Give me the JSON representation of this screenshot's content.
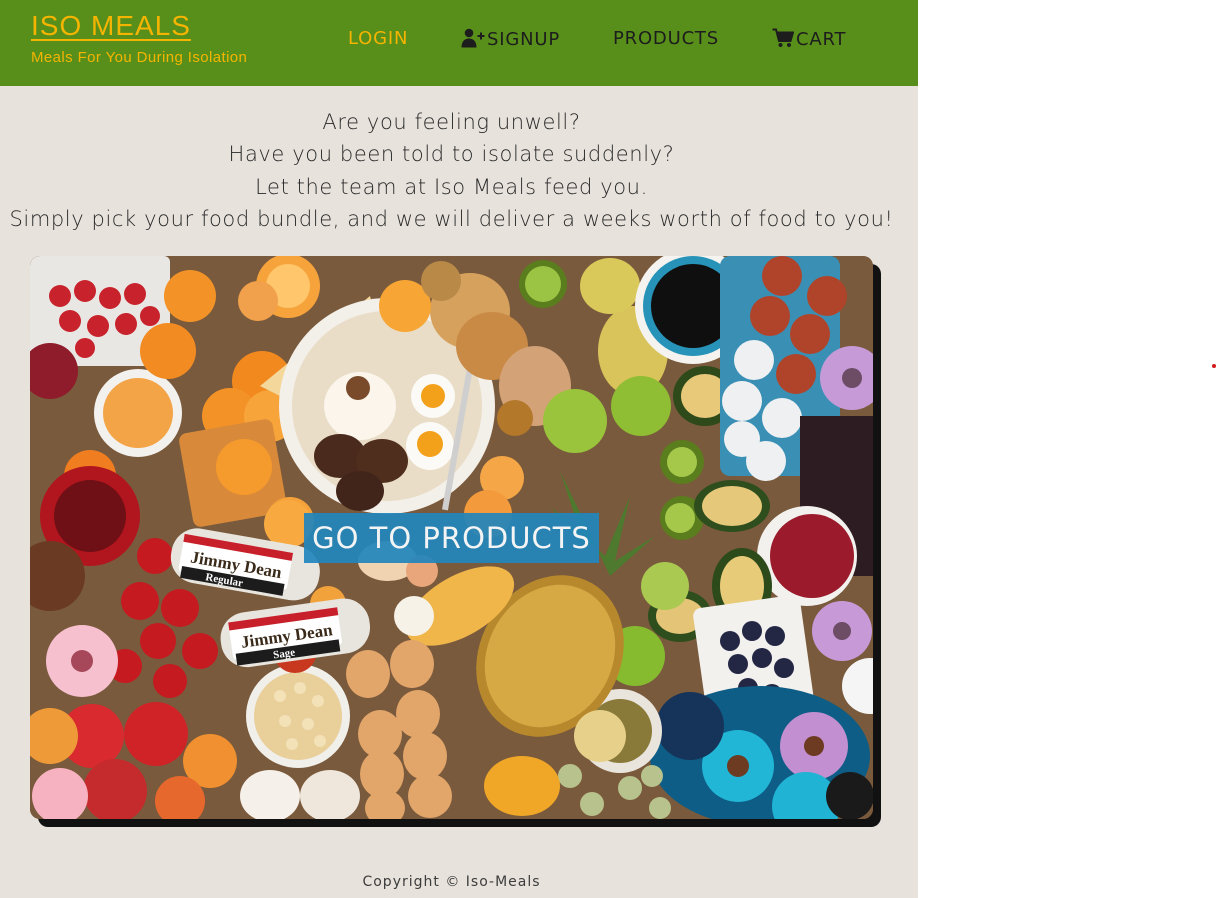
{
  "brand": {
    "title": "ISO MEALS",
    "tagline": "Meals For You During Isolation"
  },
  "nav": {
    "login": "LOGIN",
    "signup": "SIGNUP",
    "products": "PRODUCTS",
    "cart": "CART"
  },
  "intro": {
    "line1": "Are you feeling unwell?",
    "line2": "Have you been told to isolate suddenly?",
    "line3": "Let the team at Iso Meals feed you.",
    "line4": "Simply pick your food bundle, and we will deliver a weeks worth of food to you!"
  },
  "hero": {
    "cta": "GO TO PRODUCTS",
    "label_regular": "Regular",
    "label_sage": "Sage",
    "brand_label": "Jimmy Dean"
  },
  "footer": {
    "copyright": "Copyright © Iso-Meals"
  },
  "colors": {
    "navbar": "#588f1a",
    "accent": "#f5b400",
    "background": "#e7e2dc",
    "cta": "#2185bd"
  },
  "icons": {
    "signup": "user-plus-icon",
    "cart": "shopping-cart-icon"
  }
}
